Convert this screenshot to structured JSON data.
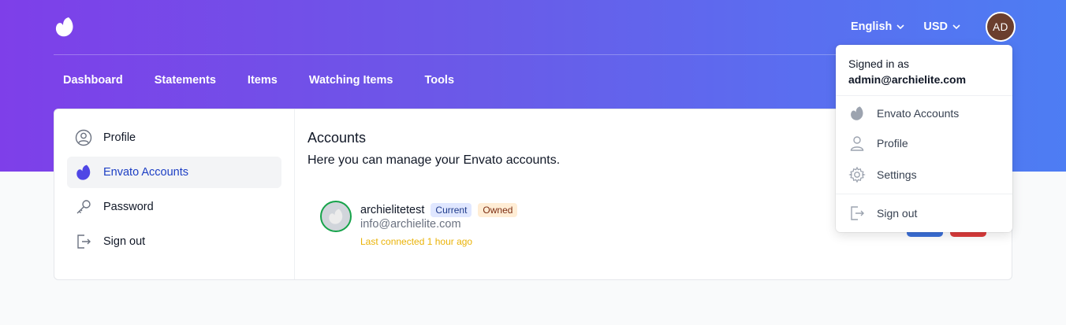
{
  "header": {
    "language": "English",
    "currency": "USD",
    "avatar_initials": "AD",
    "nav": [
      "Dashboard",
      "Statements",
      "Items",
      "Watching Items",
      "Tools"
    ]
  },
  "sidebar": {
    "items": [
      {
        "label": "Profile",
        "icon": "user-circle-icon"
      },
      {
        "label": "Envato Accounts",
        "icon": "envato-leaf-icon",
        "active": true
      },
      {
        "label": "Password",
        "icon": "key-icon"
      },
      {
        "label": "Sign out",
        "icon": "sign-out-icon"
      }
    ]
  },
  "main": {
    "title": "Accounts",
    "subtitle": "Here you can manage your Envato accounts.",
    "account": {
      "name": "archielitetest",
      "badge_current": "Current",
      "badge_owned": "Owned",
      "email": "info@archielite.com",
      "last_connected": "Last connected 1 hour ago"
    }
  },
  "dropdown": {
    "signed_in_as": "Signed in as",
    "email": "admin@archielite.com",
    "items": [
      {
        "label": "Envato Accounts",
        "icon": "envato-leaf-icon"
      },
      {
        "label": "Profile",
        "icon": "user-icon"
      },
      {
        "label": "Settings",
        "icon": "gear-icon"
      },
      {
        "label": "Sign out",
        "icon": "sign-out-icon"
      }
    ]
  },
  "colors": {
    "gradient_start": "#7e3fe9",
    "gradient_end": "#4d7df3",
    "active_text": "#1d3fc4",
    "last_connected": "#eab308"
  }
}
